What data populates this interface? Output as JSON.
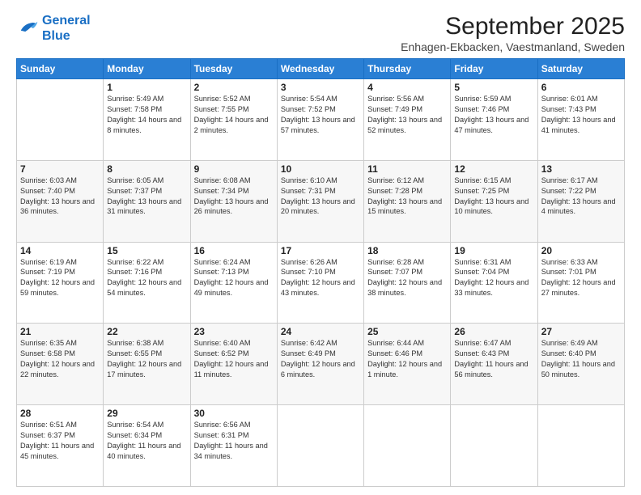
{
  "header": {
    "logo_line1": "General",
    "logo_line2": "Blue",
    "title": "September 2025",
    "subtitle": "Enhagen-Ekbacken, Vaestmanland, Sweden"
  },
  "days_of_week": [
    "Sunday",
    "Monday",
    "Tuesday",
    "Wednesday",
    "Thursday",
    "Friday",
    "Saturday"
  ],
  "weeks": [
    [
      {
        "day": "",
        "sunrise": "",
        "sunset": "",
        "daylight": ""
      },
      {
        "day": "1",
        "sunrise": "Sunrise: 5:49 AM",
        "sunset": "Sunset: 7:58 PM",
        "daylight": "Daylight: 14 hours and 8 minutes."
      },
      {
        "day": "2",
        "sunrise": "Sunrise: 5:52 AM",
        "sunset": "Sunset: 7:55 PM",
        "daylight": "Daylight: 14 hours and 2 minutes."
      },
      {
        "day": "3",
        "sunrise": "Sunrise: 5:54 AM",
        "sunset": "Sunset: 7:52 PM",
        "daylight": "Daylight: 13 hours and 57 minutes."
      },
      {
        "day": "4",
        "sunrise": "Sunrise: 5:56 AM",
        "sunset": "Sunset: 7:49 PM",
        "daylight": "Daylight: 13 hours and 52 minutes."
      },
      {
        "day": "5",
        "sunrise": "Sunrise: 5:59 AM",
        "sunset": "Sunset: 7:46 PM",
        "daylight": "Daylight: 13 hours and 47 minutes."
      },
      {
        "day": "6",
        "sunrise": "Sunrise: 6:01 AM",
        "sunset": "Sunset: 7:43 PM",
        "daylight": "Daylight: 13 hours and 41 minutes."
      }
    ],
    [
      {
        "day": "7",
        "sunrise": "Sunrise: 6:03 AM",
        "sunset": "Sunset: 7:40 PM",
        "daylight": "Daylight: 13 hours and 36 minutes."
      },
      {
        "day": "8",
        "sunrise": "Sunrise: 6:05 AM",
        "sunset": "Sunset: 7:37 PM",
        "daylight": "Daylight: 13 hours and 31 minutes."
      },
      {
        "day": "9",
        "sunrise": "Sunrise: 6:08 AM",
        "sunset": "Sunset: 7:34 PM",
        "daylight": "Daylight: 13 hours and 26 minutes."
      },
      {
        "day": "10",
        "sunrise": "Sunrise: 6:10 AM",
        "sunset": "Sunset: 7:31 PM",
        "daylight": "Daylight: 13 hours and 20 minutes."
      },
      {
        "day": "11",
        "sunrise": "Sunrise: 6:12 AM",
        "sunset": "Sunset: 7:28 PM",
        "daylight": "Daylight: 13 hours and 15 minutes."
      },
      {
        "day": "12",
        "sunrise": "Sunrise: 6:15 AM",
        "sunset": "Sunset: 7:25 PM",
        "daylight": "Daylight: 13 hours and 10 minutes."
      },
      {
        "day": "13",
        "sunrise": "Sunrise: 6:17 AM",
        "sunset": "Sunset: 7:22 PM",
        "daylight": "Daylight: 13 hours and 4 minutes."
      }
    ],
    [
      {
        "day": "14",
        "sunrise": "Sunrise: 6:19 AM",
        "sunset": "Sunset: 7:19 PM",
        "daylight": "Daylight: 12 hours and 59 minutes."
      },
      {
        "day": "15",
        "sunrise": "Sunrise: 6:22 AM",
        "sunset": "Sunset: 7:16 PM",
        "daylight": "Daylight: 12 hours and 54 minutes."
      },
      {
        "day": "16",
        "sunrise": "Sunrise: 6:24 AM",
        "sunset": "Sunset: 7:13 PM",
        "daylight": "Daylight: 12 hours and 49 minutes."
      },
      {
        "day": "17",
        "sunrise": "Sunrise: 6:26 AM",
        "sunset": "Sunset: 7:10 PM",
        "daylight": "Daylight: 12 hours and 43 minutes."
      },
      {
        "day": "18",
        "sunrise": "Sunrise: 6:28 AM",
        "sunset": "Sunset: 7:07 PM",
        "daylight": "Daylight: 12 hours and 38 minutes."
      },
      {
        "day": "19",
        "sunrise": "Sunrise: 6:31 AM",
        "sunset": "Sunset: 7:04 PM",
        "daylight": "Daylight: 12 hours and 33 minutes."
      },
      {
        "day": "20",
        "sunrise": "Sunrise: 6:33 AM",
        "sunset": "Sunset: 7:01 PM",
        "daylight": "Daylight: 12 hours and 27 minutes."
      }
    ],
    [
      {
        "day": "21",
        "sunrise": "Sunrise: 6:35 AM",
        "sunset": "Sunset: 6:58 PM",
        "daylight": "Daylight: 12 hours and 22 minutes."
      },
      {
        "day": "22",
        "sunrise": "Sunrise: 6:38 AM",
        "sunset": "Sunset: 6:55 PM",
        "daylight": "Daylight: 12 hours and 17 minutes."
      },
      {
        "day": "23",
        "sunrise": "Sunrise: 6:40 AM",
        "sunset": "Sunset: 6:52 PM",
        "daylight": "Daylight: 12 hours and 11 minutes."
      },
      {
        "day": "24",
        "sunrise": "Sunrise: 6:42 AM",
        "sunset": "Sunset: 6:49 PM",
        "daylight": "Daylight: 12 hours and 6 minutes."
      },
      {
        "day": "25",
        "sunrise": "Sunrise: 6:44 AM",
        "sunset": "Sunset: 6:46 PM",
        "daylight": "Daylight: 12 hours and 1 minute."
      },
      {
        "day": "26",
        "sunrise": "Sunrise: 6:47 AM",
        "sunset": "Sunset: 6:43 PM",
        "daylight": "Daylight: 11 hours and 56 minutes."
      },
      {
        "day": "27",
        "sunrise": "Sunrise: 6:49 AM",
        "sunset": "Sunset: 6:40 PM",
        "daylight": "Daylight: 11 hours and 50 minutes."
      }
    ],
    [
      {
        "day": "28",
        "sunrise": "Sunrise: 6:51 AM",
        "sunset": "Sunset: 6:37 PM",
        "daylight": "Daylight: 11 hours and 45 minutes."
      },
      {
        "day": "29",
        "sunrise": "Sunrise: 6:54 AM",
        "sunset": "Sunset: 6:34 PM",
        "daylight": "Daylight: 11 hours and 40 minutes."
      },
      {
        "day": "30",
        "sunrise": "Sunrise: 6:56 AM",
        "sunset": "Sunset: 6:31 PM",
        "daylight": "Daylight: 11 hours and 34 minutes."
      },
      {
        "day": "",
        "sunrise": "",
        "sunset": "",
        "daylight": ""
      },
      {
        "day": "",
        "sunrise": "",
        "sunset": "",
        "daylight": ""
      },
      {
        "day": "",
        "sunrise": "",
        "sunset": "",
        "daylight": ""
      },
      {
        "day": "",
        "sunrise": "",
        "sunset": "",
        "daylight": ""
      }
    ]
  ]
}
